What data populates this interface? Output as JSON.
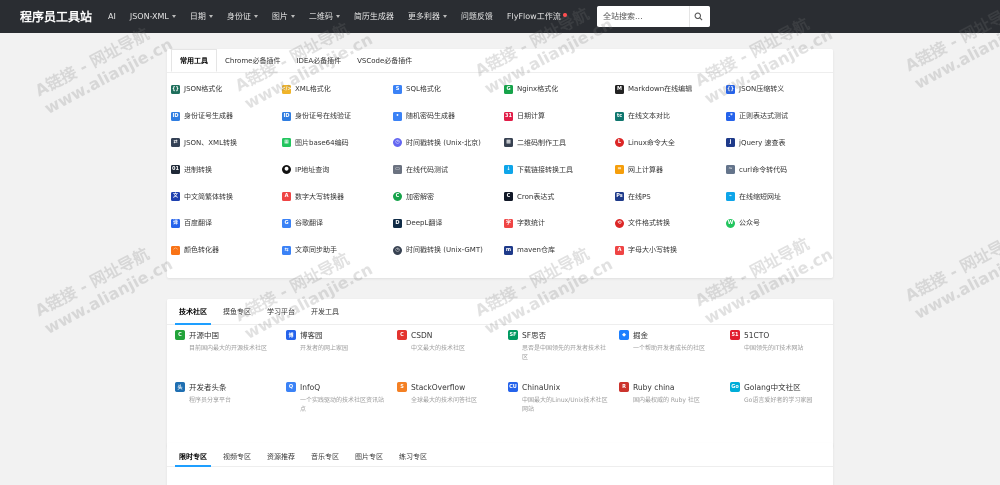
{
  "brand": "程序员工具站",
  "nav": [
    {
      "label": "AI",
      "caret": false
    },
    {
      "label": "JSON-XML",
      "caret": true
    },
    {
      "label": "日期",
      "caret": true
    },
    {
      "label": "身份证",
      "caret": true
    },
    {
      "label": "图片",
      "caret": true
    },
    {
      "label": "二维码",
      "caret": true
    },
    {
      "label": "简历生成器",
      "caret": false
    },
    {
      "label": "更多利器",
      "caret": true
    },
    {
      "label": "问题反馈",
      "caret": false
    },
    {
      "label": "FlyFlow工作流",
      "caret": false,
      "dot": true
    }
  ],
  "search": {
    "placeholder": "全站搜索..."
  },
  "tools_card": {
    "tabs": [
      "常用工具",
      "Chrome必备插件",
      "IDEA必备插件",
      "VSCode必备插件"
    ],
    "items": [
      {
        "label": "JSON格式化",
        "icon": "json-icon",
        "color": "#1f6f5c",
        "glyph": "{}"
      },
      {
        "label": "XML格式化",
        "icon": "xml-icon",
        "color": "#f0b429",
        "glyph": "</>"
      },
      {
        "label": "SQL格式化",
        "icon": "sql-icon",
        "color": "#3b82f6",
        "glyph": "S"
      },
      {
        "label": "Nginx格式化",
        "icon": "nginx-icon",
        "color": "#16a34a",
        "glyph": "G"
      },
      {
        "label": "Markdown在线编辑",
        "icon": "markdown-icon",
        "color": "#222222",
        "glyph": "M"
      },
      {
        "label": "JSON压缩转义",
        "icon": "json-compress-icon",
        "color": "#2563eb",
        "glyph": "{}"
      },
      {
        "label": "身份证号生成器",
        "icon": "id-card-icon",
        "color": "#2f7de1",
        "glyph": "ID"
      },
      {
        "label": "身份证号在线验证",
        "icon": "id-verify-icon",
        "color": "#2f7de1",
        "glyph": "ID"
      },
      {
        "label": "随机密码生成器",
        "icon": "lock-icon",
        "color": "#3b82f6",
        "glyph": "•"
      },
      {
        "label": "日期计算",
        "icon": "calendar-icon",
        "color": "#e11d48",
        "glyph": "31"
      },
      {
        "label": "在线文本对比",
        "icon": "text-diff-icon",
        "color": "#0f766e",
        "glyph": "tc"
      },
      {
        "label": "正则表达式测试",
        "icon": "regex-icon",
        "color": "#2563eb",
        "glyph": ".*"
      },
      {
        "label": "JSON、XML转换",
        "icon": "convert-icon",
        "color": "#334155",
        "glyph": "⇄"
      },
      {
        "label": "图片base64编码",
        "icon": "image-icon",
        "color": "#22c55e",
        "glyph": "▦"
      },
      {
        "label": "时间戳转换 (Unix-北京)",
        "icon": "clock-icon",
        "color": "#6366f1",
        "glyph": "◷",
        "round": true
      },
      {
        "label": "二维码制作工具",
        "icon": "qrcode-icon",
        "color": "#374151",
        "glyph": "▩"
      },
      {
        "label": "Linux命令大全",
        "icon": "linux-icon",
        "color": "#dc2626",
        "glyph": "L",
        "round": true
      },
      {
        "label": "jQuery 速查表",
        "icon": "jquery-icon",
        "color": "#1e3a8a",
        "glyph": "j"
      },
      {
        "label": "进制转换",
        "icon": "binary-icon",
        "color": "#1f2937",
        "glyph": "01"
      },
      {
        "label": "IP地址查询",
        "icon": "location-icon",
        "color": "#111111",
        "glyph": "●",
        "round": true
      },
      {
        "label": "在线代码测试",
        "icon": "monitor-icon",
        "color": "#6b7280",
        "glyph": "▭"
      },
      {
        "label": "下载链接转换工具",
        "icon": "download-icon",
        "color": "#0ea5e9",
        "glyph": "↓"
      },
      {
        "label": "网上计算器",
        "icon": "calculator-icon",
        "color": "#f59e0b",
        "glyph": "="
      },
      {
        "label": "curl命令转代码",
        "icon": "curl-icon",
        "color": "#64748b",
        "glyph": "~"
      },
      {
        "label": "中文简繁体转换",
        "icon": "chinese-convert-icon",
        "color": "#1e40af",
        "glyph": "文"
      },
      {
        "label": "数字大写转换器",
        "icon": "number-case-icon",
        "color": "#ef4444",
        "glyph": "A"
      },
      {
        "label": "加密解密",
        "icon": "encrypt-icon",
        "color": "#16a34a",
        "glyph": "C",
        "round": true
      },
      {
        "label": "Cron表达式",
        "icon": "cron-icon",
        "color": "#111827",
        "glyph": "C"
      },
      {
        "label": "在线PS",
        "icon": "ps-icon",
        "color": "#1e3a8a",
        "glyph": "Ps"
      },
      {
        "label": "在线缩短网址",
        "icon": "link-icon",
        "color": "#0ea5e9",
        "glyph": "⌁"
      },
      {
        "label": "百度翻译",
        "icon": "baidu-translate-icon",
        "color": "#2563eb",
        "glyph": "译"
      },
      {
        "label": "谷歌翻译",
        "icon": "google-translate-icon",
        "color": "#3b82f6",
        "glyph": "G"
      },
      {
        "label": "DeepL翻译",
        "icon": "deepl-icon",
        "color": "#0f2b46",
        "glyph": "D"
      },
      {
        "label": "字数统计",
        "icon": "word-count-icon",
        "color": "#ef4444",
        "glyph": "字"
      },
      {
        "label": "文件格式转换",
        "icon": "file-convert-icon",
        "color": "#dc2626",
        "glyph": "⟲",
        "round": true
      },
      {
        "label": "公众号",
        "icon": "wechat-icon",
        "color": "#22c55e",
        "glyph": "W",
        "round": true
      },
      {
        "label": "颜色转化器",
        "icon": "rainbow-icon",
        "color": "#f97316",
        "glyph": "◠"
      },
      {
        "label": "文章同步助手",
        "icon": "sync-icon",
        "color": "#3b82f6",
        "glyph": "⇆"
      },
      {
        "label": "时间戳转换 (Unix-GMT)",
        "icon": "clock-gmt-icon",
        "color": "#374151",
        "glyph": "◷",
        "round": true
      },
      {
        "label": "maven仓库",
        "icon": "maven-icon",
        "color": "#1e3a8a",
        "glyph": "m"
      },
      {
        "label": "字母大小写转换",
        "icon": "letter-case-icon",
        "color": "#ef4444",
        "glyph": "A"
      }
    ]
  },
  "community_card": {
    "tabs": [
      "技术社区",
      "摸鱼专区",
      "学习平台",
      "开发工具"
    ],
    "items": [
      {
        "title": "开源中国",
        "desc": "目前国内最大的开源技术社区",
        "icon": "oschina-icon",
        "color": "#22a33a",
        "glyph": "C"
      },
      {
        "title": "博客园",
        "desc": "开发者的网上家园",
        "icon": "cnblogs-icon",
        "color": "#2563eb",
        "glyph": "博"
      },
      {
        "title": "CSDN",
        "desc": "中文最大的技术社区",
        "icon": "csdn-icon",
        "color": "#e3342f",
        "glyph": "C"
      },
      {
        "title": "SF思否",
        "desc": "思否是中国领先的开发者技术社区",
        "icon": "segmentfault-icon",
        "color": "#009a61",
        "glyph": "SF"
      },
      {
        "title": "掘金",
        "desc": "一个帮助开发者成长的社区",
        "icon": "juejin-icon",
        "color": "#1e80ff",
        "glyph": "◆"
      },
      {
        "title": "51CTO",
        "desc": "中国领先的IT技术网站",
        "icon": "51cto-icon",
        "color": "#e11d2e",
        "glyph": "51"
      },
      {
        "title": "开发者头条",
        "desc": "程序员分享平台",
        "icon": "toutiao-icon",
        "color": "#1f6fb2",
        "glyph": "头"
      },
      {
        "title": "InfoQ",
        "desc": "一个实践驱动的技术社区资讯站点",
        "icon": "infoq-icon",
        "color": "#3b82f6",
        "glyph": "Q"
      },
      {
        "title": "StackOverflow",
        "desc": "全球最大的技术问答社区",
        "icon": "stackoverflow-icon",
        "color": "#f48024",
        "glyph": "S"
      },
      {
        "title": "ChinaUnix",
        "desc": "中国最大的Linux/Unix技术社区网站",
        "icon": "chinaunix-icon",
        "color": "#2563eb",
        "glyph": "CU"
      },
      {
        "title": "Ruby china",
        "desc": "国内最权威的 Ruby 社区",
        "icon": "ruby-icon",
        "color": "#cc342d",
        "glyph": "R"
      },
      {
        "title": "Golang中文社区",
        "desc": "Go语言爱好者的学习家园",
        "icon": "golang-icon",
        "color": "#00add8",
        "glyph": "Go"
      }
    ]
  },
  "third_card": {
    "tabs": [
      "限时专区",
      "视频专区",
      "资源推荐",
      "音乐专区",
      "图片专区",
      "练习专区"
    ]
  },
  "watermark": {
    "line1": "A链接 - 网址导航",
    "line2": "www.alianjie.cn"
  }
}
